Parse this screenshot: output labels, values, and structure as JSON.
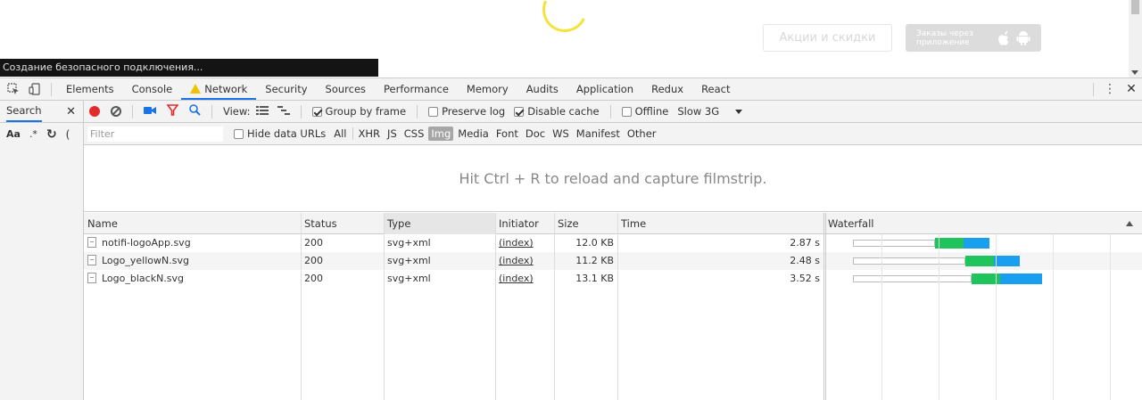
{
  "page": {
    "promo_button": "Акции и скидки",
    "app_button": "Заказы через приложение",
    "status_bubble": "Создание безопасного подключения..."
  },
  "devtools": {
    "tabs": [
      {
        "label": "Elements"
      },
      {
        "label": "Console"
      },
      {
        "label": "Network",
        "selected": true,
        "warning": true
      },
      {
        "label": "Security"
      },
      {
        "label": "Sources"
      },
      {
        "label": "Performance"
      },
      {
        "label": "Memory"
      },
      {
        "label": "Audits"
      },
      {
        "label": "Application"
      },
      {
        "label": "Redux"
      },
      {
        "label": "React"
      }
    ],
    "search_pane": {
      "title": "Search",
      "match_case": "Aa",
      "regex": ".*"
    },
    "toolbar": {
      "view_label": "View:",
      "group_by_frame": "Group by frame",
      "preserve_log": "Preserve log",
      "disable_cache": "Disable cache",
      "offline": "Offline",
      "throttling": "Slow 3G"
    },
    "filter": {
      "placeholder": "Filter",
      "hide_data_urls": "Hide data URLs",
      "types": [
        "All",
        "XHR",
        "JS",
        "CSS",
        "Img",
        "Media",
        "Font",
        "Doc",
        "WS",
        "Manifest",
        "Other"
      ],
      "active_type": "Img"
    },
    "filmstrip_message": "Hit Ctrl + R to reload and capture filmstrip.",
    "columns": {
      "name": "Name",
      "status": "Status",
      "type": "Type",
      "initiator": "Initiator",
      "size": "Size",
      "time": "Time",
      "waterfall": "Waterfall"
    },
    "rows": [
      {
        "name": "notifi-logoApp.svg",
        "status": "200",
        "type": "svg+xml",
        "initiator": "(index)",
        "size": "12.0 KB",
        "time": "2.87 s",
        "wait_end": 0.5,
        "download_end": 0.62
      },
      {
        "name": "Logo_yellowN.svg",
        "status": "200",
        "type": "svg+xml",
        "initiator": "(index)",
        "size": "11.2 KB",
        "time": "2.48 s",
        "wait_end": 0.64,
        "download_end": 0.76
      },
      {
        "name": "Logo_blackN.svg",
        "status": "200",
        "type": "svg+xml",
        "initiator": "(index)",
        "size": "13.1 KB",
        "time": "3.52 s",
        "wait_end": 0.67,
        "download_end": 0.86
      }
    ]
  },
  "colors": {
    "accent": "#1a73e8",
    "waterfall_waiting": "#1fc45d",
    "waterfall_download": "#1a9ff0",
    "record": "#e32b2b",
    "spinner": "#f5e23a"
  }
}
